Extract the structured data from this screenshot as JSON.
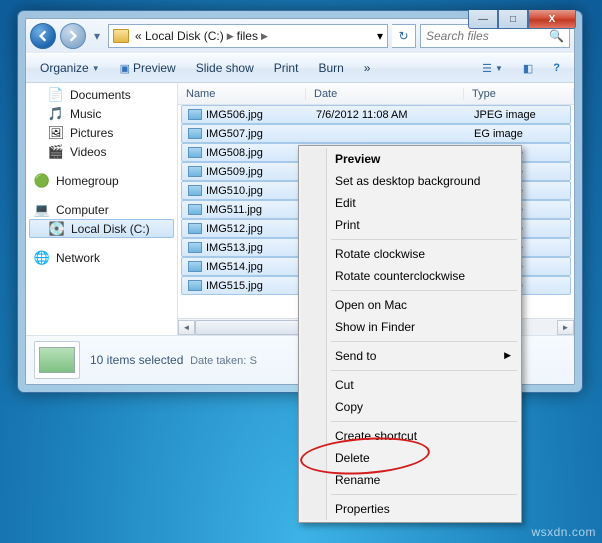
{
  "window": {
    "titlebar": {
      "min": "—",
      "max": "□",
      "close": "X"
    },
    "address": {
      "crumbs": [
        "« Local Disk (C:)",
        "files"
      ],
      "refresh_glyph": "↻"
    },
    "search": {
      "placeholder": "Search files",
      "mag_glyph": "🔍"
    }
  },
  "toolbar": {
    "organize": "Organize",
    "preview": "Preview",
    "slideshow": "Slide show",
    "print": "Print",
    "burn": "Burn",
    "more_glyph": "»"
  },
  "sidebar": {
    "libs": [
      {
        "icon": "📄",
        "label": "Documents"
      },
      {
        "icon": "🎵",
        "label": "Music"
      },
      {
        "icon": "🖼",
        "label": "Pictures"
      },
      {
        "icon": "🎬",
        "label": "Videos"
      }
    ],
    "homegroup": {
      "icon": "🟢",
      "label": "Homegroup"
    },
    "computer": {
      "icon": "💻",
      "label": "Computer"
    },
    "drive": {
      "icon": "💽",
      "label": "Local Disk (C:)"
    },
    "network": {
      "icon": "🌐",
      "label": "Network"
    }
  },
  "columns": {
    "name": "Name",
    "date": "Date",
    "type": "Type"
  },
  "files": [
    {
      "name": "IMG506.jpg",
      "date": "7/6/2012 11:08 AM",
      "type": "JPEG image"
    },
    {
      "name": "IMG507.jpg",
      "date": "",
      "type": "EG image"
    },
    {
      "name": "IMG508.jpg",
      "date": "",
      "type": "EG image"
    },
    {
      "name": "IMG509.jpg",
      "date": "",
      "type": "EG image"
    },
    {
      "name": "IMG510.jpg",
      "date": "",
      "type": "EG image"
    },
    {
      "name": "IMG511.jpg",
      "date": "",
      "type": "EG image"
    },
    {
      "name": "IMG512.jpg",
      "date": "",
      "type": "EG image"
    },
    {
      "name": "IMG513.jpg",
      "date": "",
      "type": "EG image"
    },
    {
      "name": "IMG514.jpg",
      "date": "",
      "type": "EG image"
    },
    {
      "name": "IMG515.jpg",
      "date": "",
      "type": "EG image"
    }
  ],
  "details": {
    "line1": "10 items selected",
    "label2": "Date taken:",
    "value2": "S"
  },
  "context_menu": {
    "items": [
      {
        "label": "Preview",
        "bold": true
      },
      {
        "label": "Set as desktop background"
      },
      {
        "label": "Edit"
      },
      {
        "label": "Print"
      },
      {
        "sep": true
      },
      {
        "label": "Rotate clockwise"
      },
      {
        "label": "Rotate counterclockwise"
      },
      {
        "sep": true
      },
      {
        "label": "Open on Mac"
      },
      {
        "label": "Show in Finder"
      },
      {
        "sep": true
      },
      {
        "label": "Send to",
        "submenu": true
      },
      {
        "sep": true
      },
      {
        "label": "Cut"
      },
      {
        "label": "Copy"
      },
      {
        "sep": true
      },
      {
        "label": "Create shortcut"
      },
      {
        "label": "Delete"
      },
      {
        "label": "Rename"
      },
      {
        "sep": true
      },
      {
        "label": "Properties"
      }
    ]
  },
  "watermark": "wsxdn.com"
}
